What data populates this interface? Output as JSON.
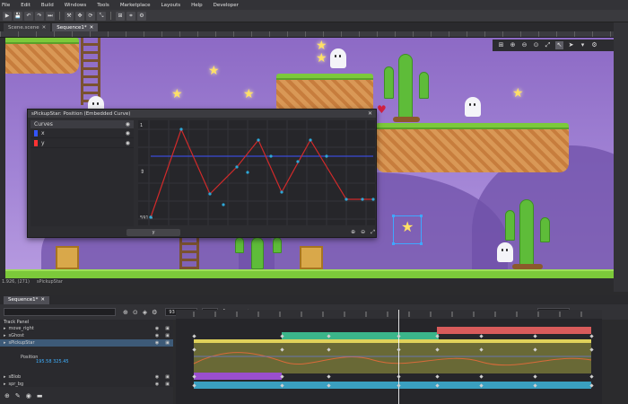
{
  "menu": [
    "File",
    "Edit",
    "Build",
    "Windows",
    "Tools",
    "Marketplace",
    "Layouts",
    "Help",
    "Developer"
  ],
  "toolbar": {
    "icons": [
      "play-icon",
      "save-icon",
      "undo-icon",
      "redo-icon",
      "step-icon",
      "build-icon",
      "move-icon",
      "rotate-icon",
      "scale-icon",
      "grid-icon",
      "snap-icon",
      "settings-icon"
    ]
  },
  "doc_tabs": [
    {
      "label": "Scene.scene",
      "active": false
    },
    {
      "label": "Sequence1*",
      "active": true
    }
  ],
  "curve_editor": {
    "title": "sPickupStar: Position (Embedded Curve)",
    "list_header": "Curves",
    "curves": [
      {
        "label": "x",
        "color": "#3355ff"
      },
      {
        "label": "y",
        "color": "#ff3333"
      }
    ],
    "y_top": "1",
    "y_bottom": "591.5",
    "bottom_button": "y",
    "colors": {
      "x_curve": "#3a4bd6",
      "y_curve": "#d12a2a",
      "points": "#2ea8d8"
    }
  },
  "status": {
    "coords": "1.926, (271)",
    "object": "sPickupStar"
  },
  "timeline": {
    "sequence_tab": "Sequence1*",
    "frame": "93",
    "fps": "60",
    "fps_label": "fps",
    "end_frame": "180",
    "tracks_header": "Track Panel",
    "tracks": [
      {
        "label": "move_right",
        "selected": false
      },
      {
        "label": "sGhost",
        "selected": false
      },
      {
        "label": "sPickupStar",
        "selected": true
      },
      {
        "label": "Position",
        "selected": false,
        "sub": true
      },
      {
        "label": "sBlob",
        "selected": false
      },
      {
        "label": "spr_bg",
        "selected": false
      }
    ],
    "position_values": "195.58  325.45"
  }
}
